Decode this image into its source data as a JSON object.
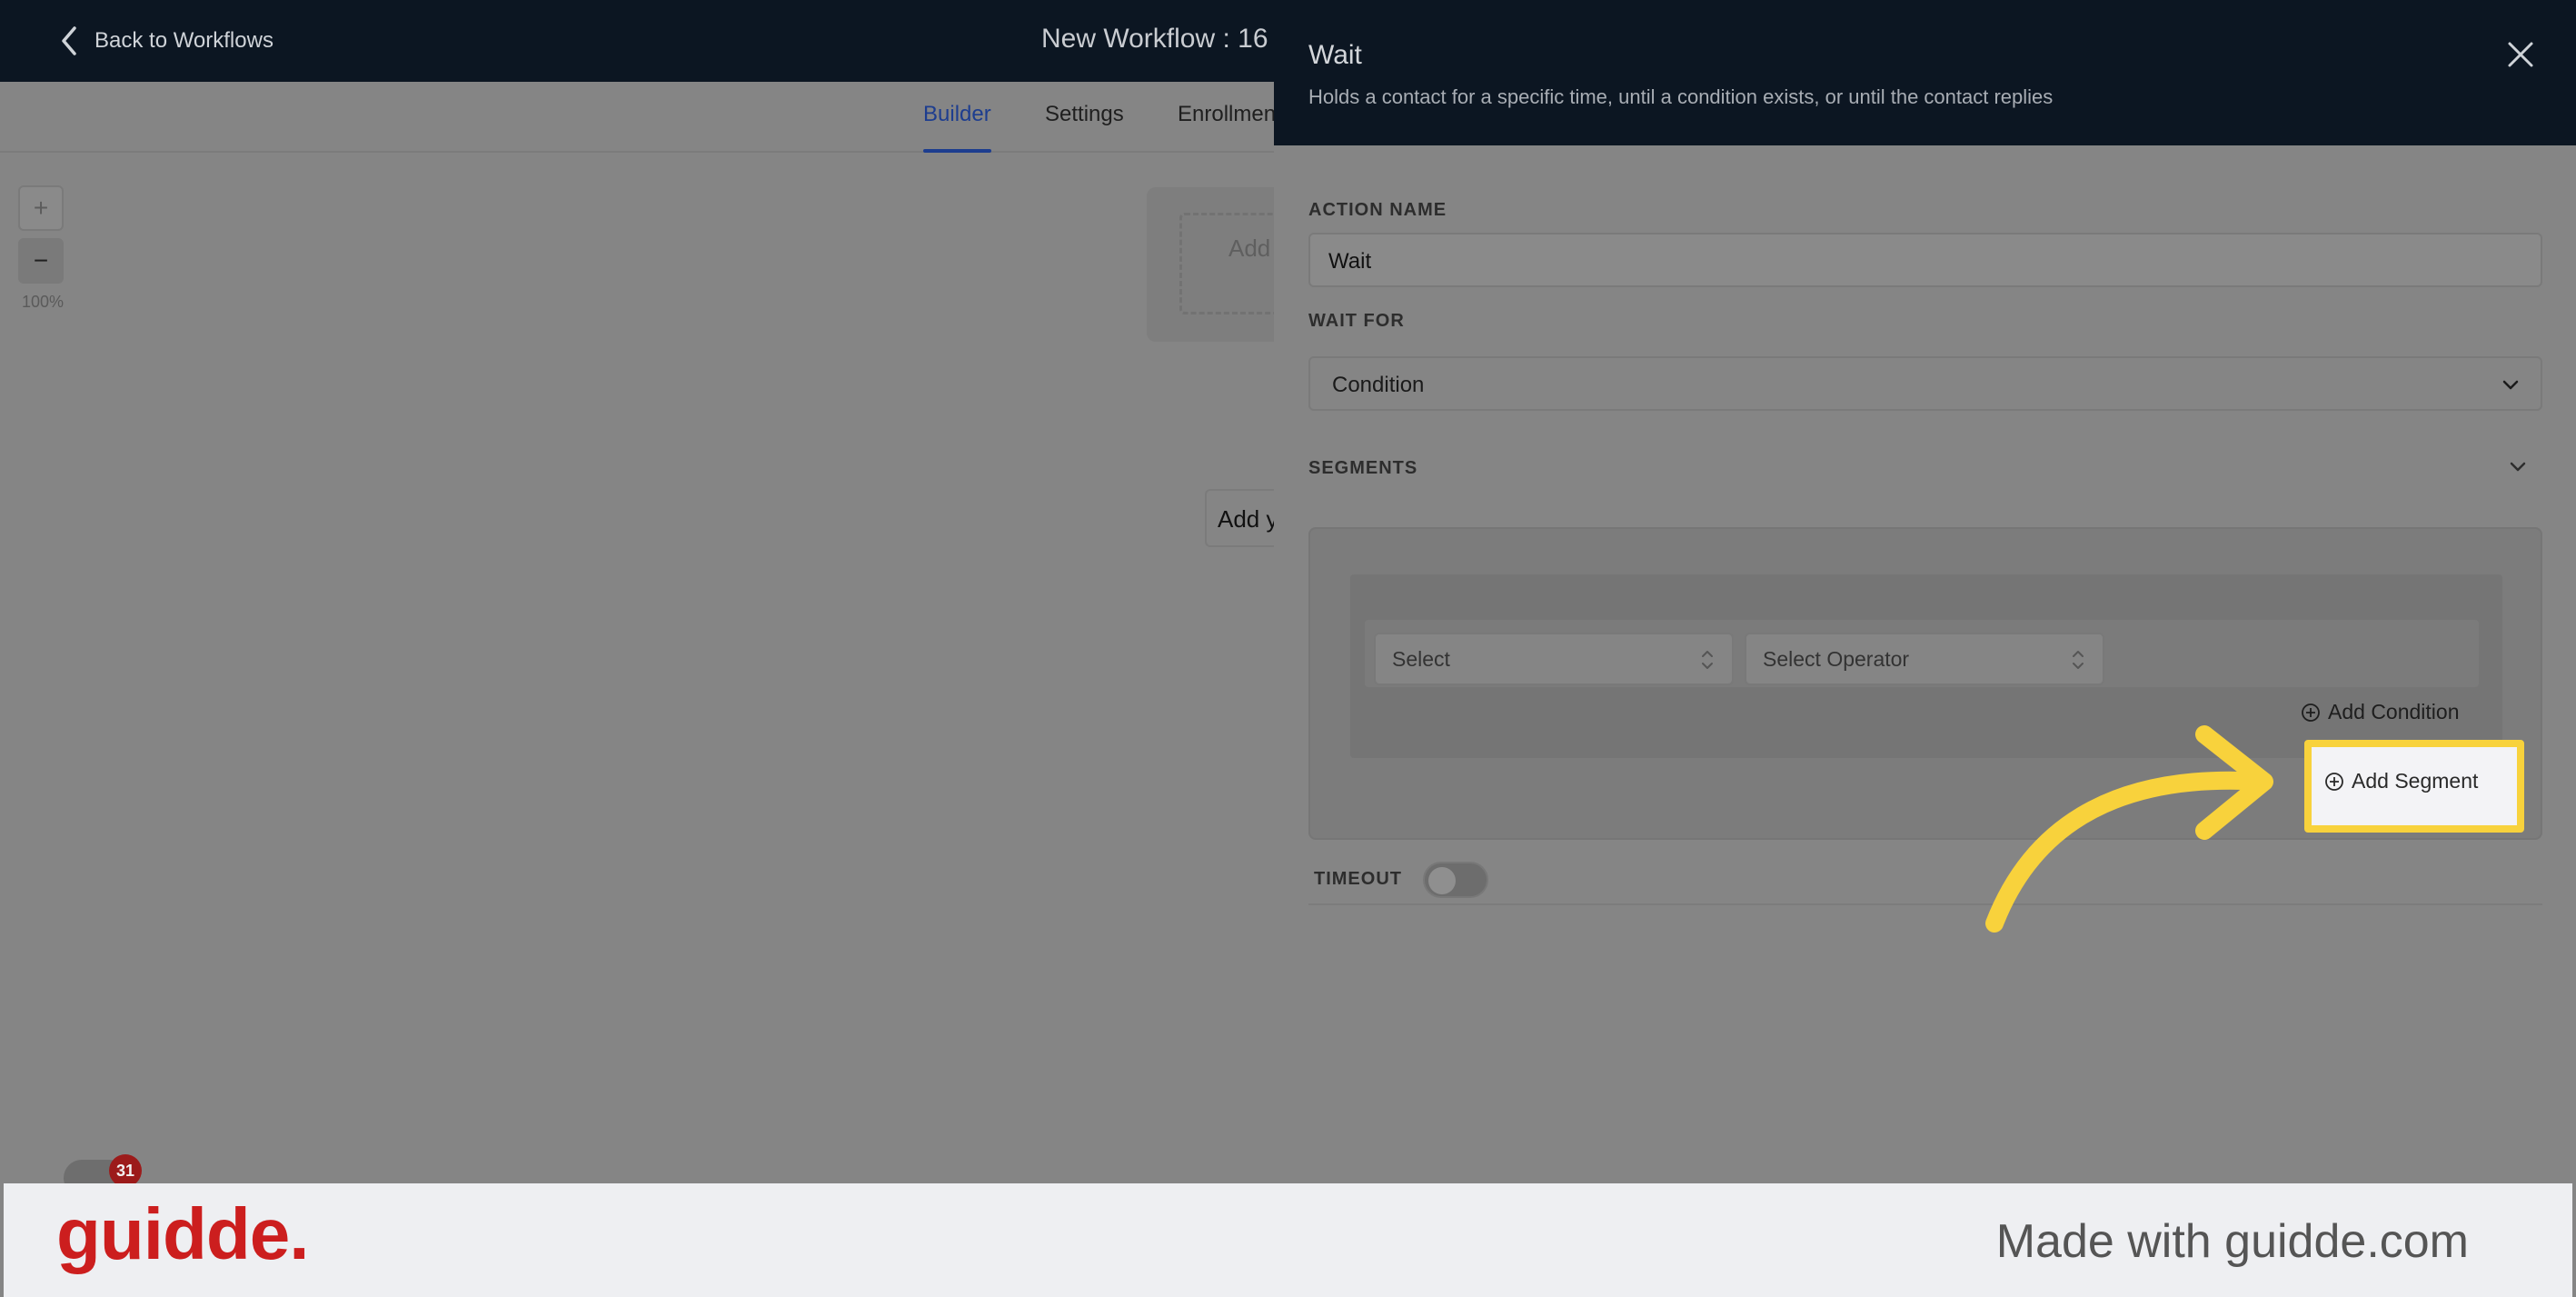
{
  "app": {
    "back_label": "Back to Workflows",
    "workflow_title": "New Workflow : 16",
    "tabs": [
      {
        "label": "Builder",
        "active": true
      },
      {
        "label": "Settings",
        "active": false
      },
      {
        "label": "Enrollmen",
        "active": false
      }
    ],
    "zoom_in": "+",
    "zoom_out": "−",
    "zoom_level": "100%",
    "trigger_text": "Add",
    "add_action_text": "Add y",
    "chat_badge": "31"
  },
  "panel": {
    "title": "Wait",
    "description": "Holds a contact for a specific time, until a condition exists, or until the contact replies",
    "action_name_label": "ACTION NAME",
    "action_name_value": "Wait",
    "wait_for_label": "WAIT FOR",
    "wait_for_value": "Condition",
    "segments_label": "SEGMENTS",
    "condition_field_placeholder": "Select",
    "condition_operator_placeholder": "Select Operator",
    "add_condition_label": "Add Condition",
    "add_segment_label": "Add Segment",
    "timeout_label": "TIMEOUT",
    "timeout_enabled": false
  },
  "footer": {
    "logo": "guidde.",
    "tagline": "Made with guidde.com"
  },
  "colors": {
    "header_bg": "#0c1622",
    "highlight": "#f8d23c",
    "logo": "#cc1e1e",
    "active_tab": "#1d3d8f"
  }
}
